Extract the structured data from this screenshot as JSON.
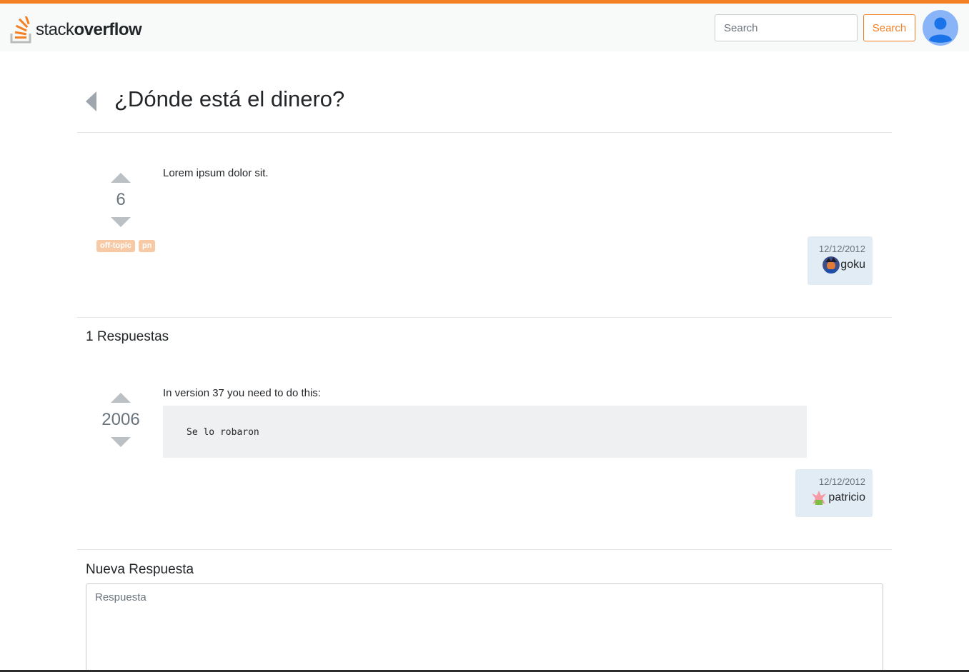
{
  "header": {
    "logo_text_light": "stack",
    "logo_text_bold": "overflow",
    "search_placeholder": "Search",
    "search_button_label": "Search"
  },
  "question": {
    "title": "¿Dónde está el dinero?",
    "body": "Lorem ipsum dolor sit.",
    "votes": "6",
    "tags": [
      "off-topic",
      "pn"
    ],
    "date": "12/12/2012",
    "author": "goku"
  },
  "answers_section": {
    "heading": "1 Respuestas",
    "answers": [
      {
        "body": "In version 37 you need to do this:",
        "code": "Se lo robaron",
        "votes": "2006",
        "date": "12/12/2012",
        "author": "patricio"
      }
    ]
  },
  "new_answer": {
    "heading": "Nueva Respuesta",
    "placeholder": "Respuesta"
  },
  "colors": {
    "brand": "#f48024",
    "card_bg": "#e1ecf4",
    "tag_bg": "#f7c9a4",
    "vote_arrow": "#bbc0c4"
  }
}
